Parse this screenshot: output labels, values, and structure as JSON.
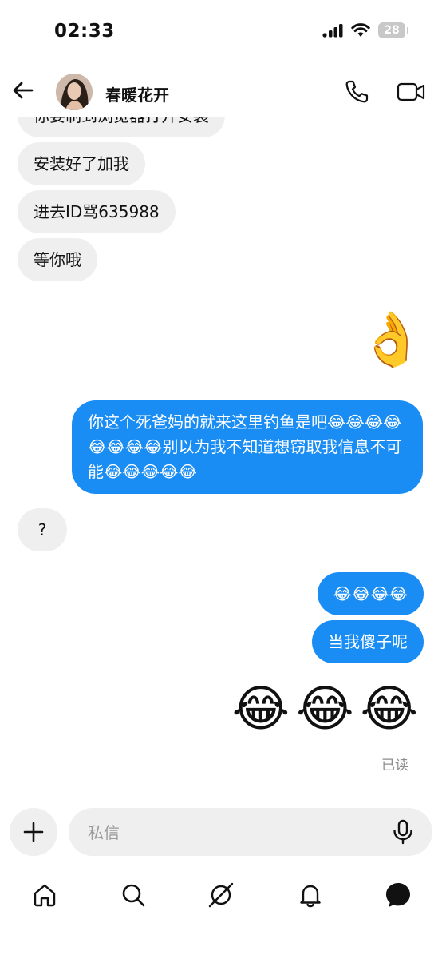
{
  "status_bar": {
    "time": "02:33",
    "battery": "28"
  },
  "header": {
    "contact_name": "春暖花开"
  },
  "messages": [
    {
      "direction": "in",
      "text": "你要制到浏览器打开安装"
    },
    {
      "direction": "in",
      "text": "安装好了加我"
    },
    {
      "direction": "in",
      "text": "进去ID骂635988"
    },
    {
      "direction": "in",
      "text": "等你哦"
    },
    {
      "direction": "out",
      "text": "👌"
    },
    {
      "direction": "out",
      "text": "你这个死爸妈的就来这里钓鱼是吧😂😂😂😂😂😂😂😂别以为我不知道想窃取我信息不可能😂😂😂😂😂"
    },
    {
      "direction": "in",
      "text": "?"
    },
    {
      "direction": "out",
      "text": "😂😂😂😂"
    },
    {
      "direction": "out",
      "text": "当我傻子呢"
    },
    {
      "direction": "out",
      "text": "😂😂😂"
    }
  ],
  "seen_label": "已读",
  "composer": {
    "placeholder": "私信"
  },
  "bottom_nav": [
    {
      "icon": "home-icon"
    },
    {
      "icon": "search-icon"
    },
    {
      "icon": "explore-icon"
    },
    {
      "icon": "notifications-bell-icon"
    },
    {
      "icon": "messages-bubble-icon"
    }
  ],
  "colors": {
    "outgoing_bubble": "#1a8df5",
    "incoming_bubble": "#efefef",
    "seen_text": "#8e8e8e"
  }
}
